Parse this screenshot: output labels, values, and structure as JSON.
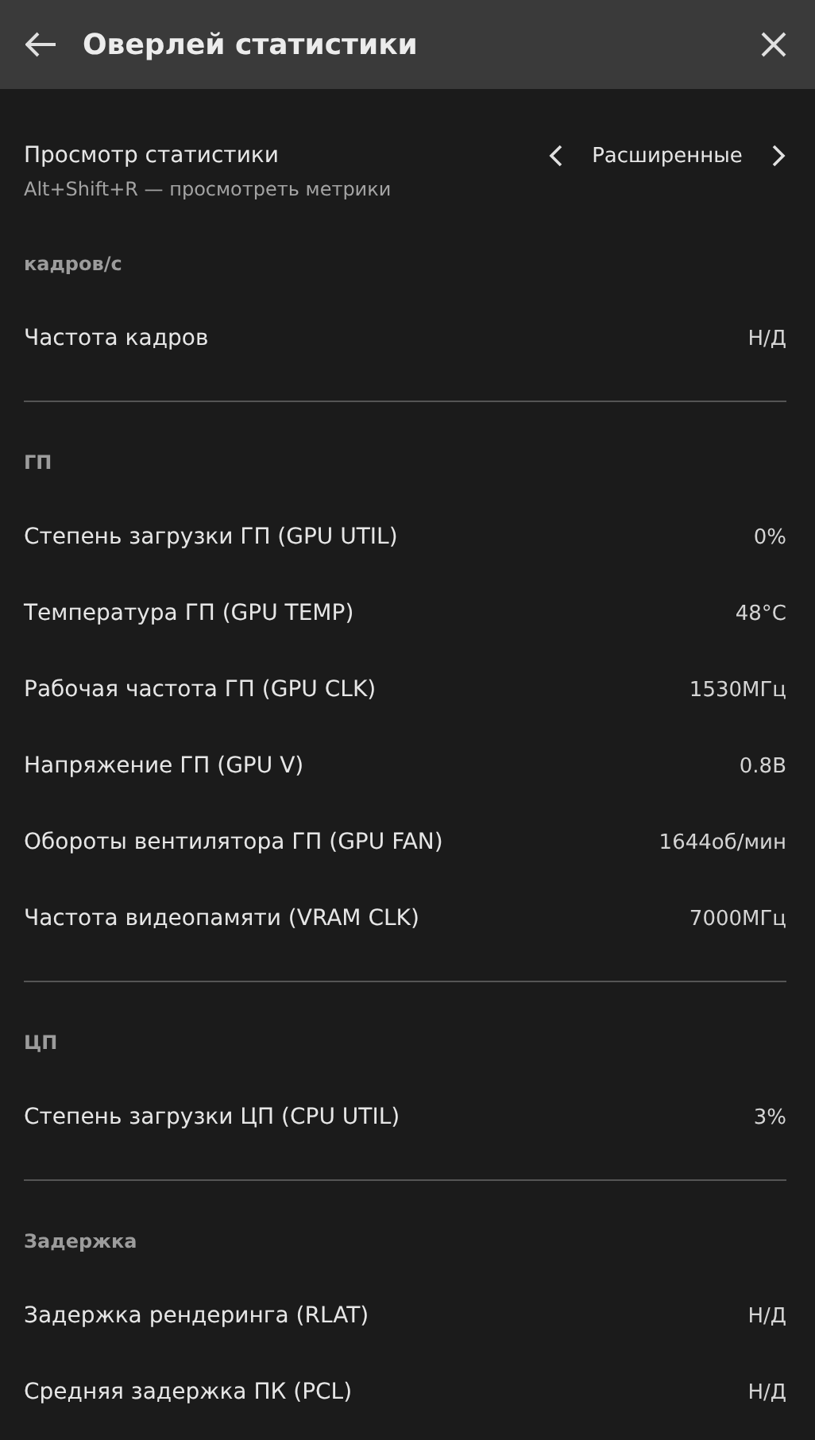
{
  "header": {
    "title": "Оверлей статистики"
  },
  "stats_view": {
    "label": "Просмотр статистики",
    "hint": "Alt+Shift+R — просмотреть метрики",
    "value": "Расширенные"
  },
  "sections": [
    {
      "heading": "кадров/с",
      "rows": [
        {
          "label": "Частота кадров",
          "value": "Н/Д"
        }
      ]
    },
    {
      "heading": "ГП",
      "rows": [
        {
          "label": "Степень загрузки ГП (GPU UTIL)",
          "value": "0%"
        },
        {
          "label": "Температура ГП (GPU TEMP)",
          "value": "48°C"
        },
        {
          "label": "Рабочая частота ГП (GPU CLK)",
          "value": "1530МГц"
        },
        {
          "label": "Напряжение ГП (GPU V)",
          "value": "0.8В"
        },
        {
          "label": "Обороты вентилятора ГП (GPU FAN)",
          "value": "1644об/мин"
        },
        {
          "label": "Частота видеопамяти (VRAM CLK)",
          "value": "7000МГц"
        }
      ]
    },
    {
      "heading": "ЦП",
      "rows": [
        {
          "label": "Степень загрузки ЦП (CPU UTIL)",
          "value": "3%"
        }
      ]
    },
    {
      "heading": "Задержка",
      "rows": [
        {
          "label": "Задержка рендеринга (RLAT)",
          "value": "Н/Д"
        },
        {
          "label": "Средняя задержка ПК (PCL)",
          "value": "Н/Д"
        }
      ]
    }
  ]
}
